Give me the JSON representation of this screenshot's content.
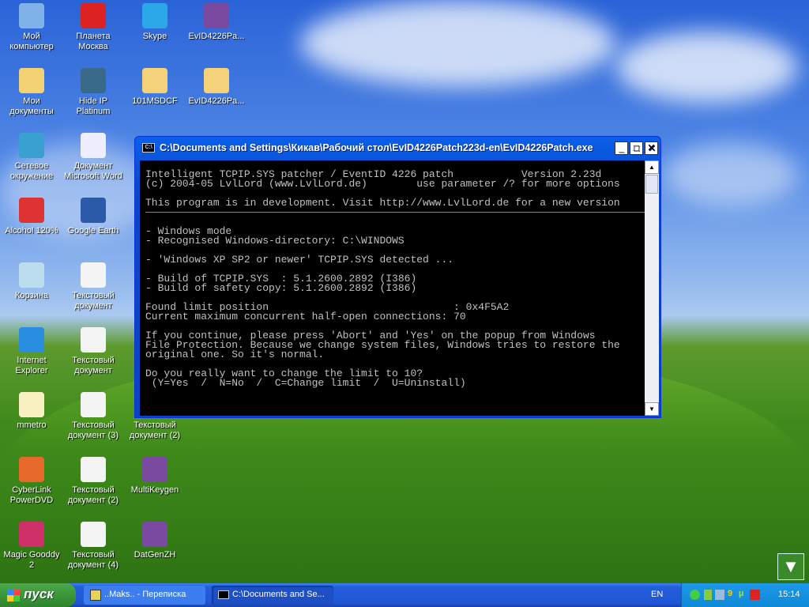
{
  "desktop": {
    "icons": [
      {
        "label": "Мой компьютер",
        "color": "#7fb2e8"
      },
      {
        "label": "Планета Москва",
        "color": "#d22"
      },
      {
        "label": "Skype",
        "color": "#2aa8e8"
      },
      {
        "label": "EvID4226Pa...",
        "color": "#7a4aa0"
      },
      {
        "label": "Мои документы",
        "color": "#f2d272"
      },
      {
        "label": "Hide IP Platinum",
        "color": "#3a6a8a"
      },
      {
        "label": "101MSDCF",
        "color": "#f4d27a"
      },
      {
        "label": "EvID4226Pa...",
        "color": "#f4d27a"
      },
      {
        "label": "Сетевое окружение",
        "color": "#3aa0d0"
      },
      {
        "label": "Документ Microsoft Word",
        "color": "#eef"
      },
      {
        "label": "Alcohol 120%",
        "color": "#d33"
      },
      {
        "label": "Google Earth",
        "color": "#2a5aa8"
      },
      {
        "label": "Корзина",
        "color": "#bde"
      },
      {
        "label": "Текстовый документ",
        "color": "#f4f4f4"
      },
      {
        "label": "Internet Explorer",
        "color": "#2a8ee0"
      },
      {
        "label": "Текстовый документ",
        "color": "#f4f4f4"
      },
      {
        "label": "mmetro",
        "color": "#f8f0c0"
      },
      {
        "label": "Текстовый документ (3)",
        "color": "#f4f4f4"
      },
      {
        "label": "Текстовый документ (2)",
        "color": "#f4f4f4"
      },
      {
        "label": "CyberLink PowerDVD",
        "color": "#e86a2a"
      },
      {
        "label": "Текстовый документ (2)",
        "color": "#f4f4f4"
      },
      {
        "label": "MultiKeygen",
        "color": "#7a4aa0"
      },
      {
        "label": "Magic Gooddy 2",
        "color": "#d0306a"
      },
      {
        "label": "Текстовый документ (4)",
        "color": "#f4f4f4"
      },
      {
        "label": "DatGenZH",
        "color": "#7a4aa0"
      }
    ]
  },
  "window": {
    "title": "C:\\Documents and Settings\\Кикав\\Рабочий стол\\EvID4226Patch223d-en\\EvID4226Patch.exe",
    "header_lines": [
      "Intelligent TCPIP.SYS patcher / EventID 4226 patch           Version 2.23d",
      "(c) 2004-05 LvlLord (www.LvlLord.de)        use parameter /? for more options",
      "",
      "This program is in development. Visit http://www.LvlLord.de for a new version"
    ],
    "body_lines": [
      "",
      "- Windows mode",
      "- Recognised Windows-directory: C:\\WINDOWS",
      "",
      "- 'Windows XP SP2 or newer' TCPIP.SYS detected ...",
      "",
      "- Build of TCPIP.SYS  : 5.1.2600.2892 (I386)",
      "- Build of safety copy: 5.1.2600.2892 (I386)",
      "",
      "Found limit position                              : 0x4F5A2",
      "Current maximum concurrent half-open connections: 70",
      "",
      "If you continue, please press 'Abort' and 'Yes' on the popup from Windows",
      "File Protection. Because we change system files, Windows tries to restore the",
      "original one. So it's normal.",
      "",
      "Do you really want to change the limit to 10?",
      " (Y=Yes  /  N=No  /  C=Change limit  /  U=Uninstall)"
    ]
  },
  "taskbar": {
    "start_label": "пуск",
    "buttons": [
      {
        "label": "..Maks.. - Переписка"
      },
      {
        "label": "C:\\Documents and Se..."
      }
    ],
    "language": "EN",
    "clock": "15:14"
  }
}
